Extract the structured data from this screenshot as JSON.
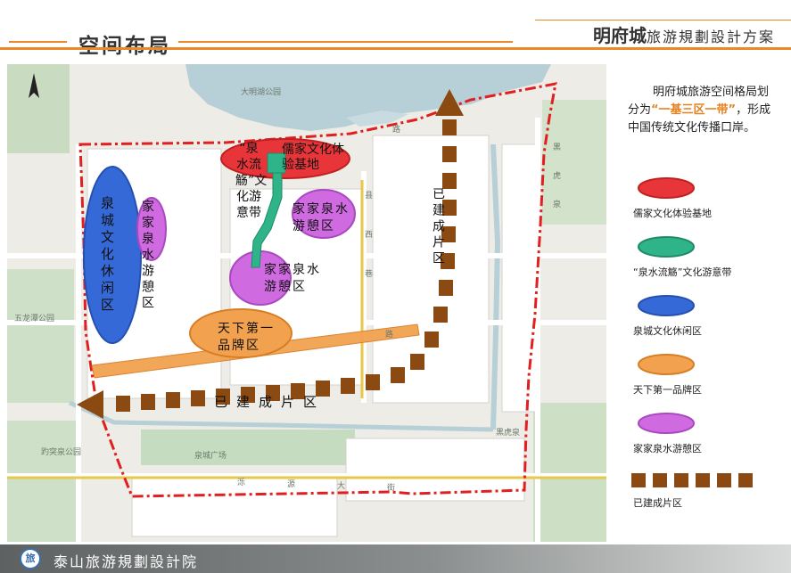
{
  "header": {
    "section_title": "空间布局",
    "plan_title_strong": "明府城",
    "plan_title_rest": "旅游規劃設計方案"
  },
  "map": {
    "place_labels": {
      "daming_lake": "大明湖公园",
      "wulongtan": "五龙潭公园",
      "baotu": "趵突泉公园",
      "quancheng_square": "泉城广场",
      "heihu": "黑虎泉"
    },
    "road_chars": [
      "路",
      "县",
      "西",
      "巷",
      "路",
      "黑",
      "虎",
      "泉",
      "泺",
      "源",
      "大",
      "街"
    ],
    "zones": {
      "confucian": "儒家文化体验基地",
      "quancheng_leisure": "泉城文化休闲区",
      "spring_belt": "“泉水流觞”文化游意带",
      "jiajia_west": "家家泉水游憩区",
      "jiajia_ne": "家家泉水游憩区",
      "jiajia_center": "家家泉水游憩区",
      "brand": "天下第一品牌区",
      "built_east": "已建成片区",
      "built_south": "已建成片区"
    },
    "colors": {
      "red_zone": "#e8353a",
      "green_belt": "#2fb48a",
      "blue_zone": "#3569d8",
      "orange_zone": "#f2a24f",
      "purple_zone": "#cf6ae0",
      "brown_arrow": "#8b4a12",
      "boundary": "#e02020"
    }
  },
  "panel": {
    "intro_a": "明府城旅游空间格局划分为",
    "intro_highlight": "“一基三区一带”",
    "intro_b": "，形成中国传统文化传播口岸。",
    "legend": [
      {
        "label": "儒家文化体验基地",
        "color": "#e8353a",
        "shape": "ellipse"
      },
      {
        "label": "“泉水流觞”文化游意带",
        "color": "#2fb48a",
        "shape": "ellipse"
      },
      {
        "label": "泉城文化休闲区",
        "color": "#3569d8",
        "shape": "ellipse"
      },
      {
        "label": "天下第一品牌区",
        "color": "#f2a24f",
        "shape": "ellipse"
      },
      {
        "label": "家家泉水游憩区",
        "color": "#cf6ae0",
        "shape": "ellipse"
      },
      {
        "label": "已建成片区",
        "color": "#8b4a12",
        "shape": "dashes"
      }
    ]
  },
  "footer": {
    "logo_glyph": "旅",
    "org_name": "泰山旅游規劃設計院"
  }
}
